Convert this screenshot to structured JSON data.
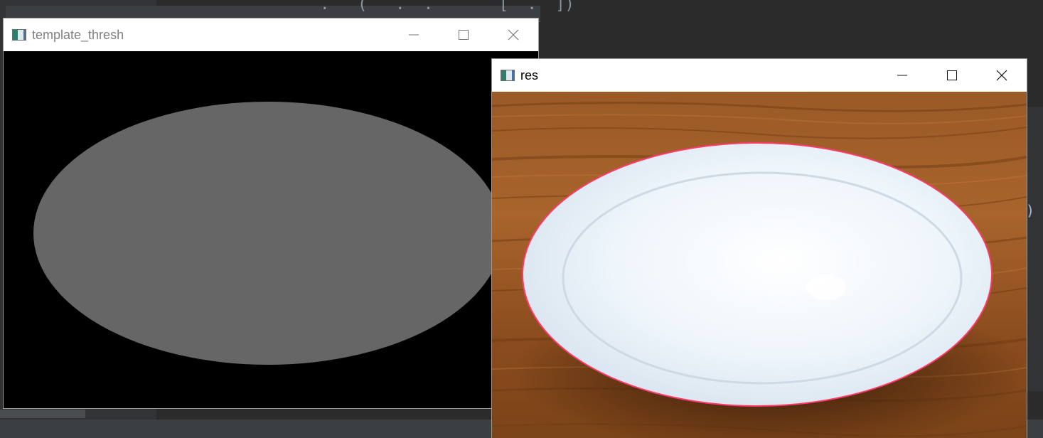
{
  "ide": {
    "code_fragment": "                 .   (   .  .       [  .  ])",
    "scroll_marker": ")"
  },
  "windows": [
    {
      "title": "template_thresh",
      "active": false,
      "image_description_name": "thresholded-ellipse-template",
      "colors": {
        "background": "#000000",
        "ellipse": "#666666"
      }
    },
    {
      "title": "res",
      "active": true,
      "image_description_name": "plate-on-wooden-table-with-contour",
      "colors": {
        "wood_dark": "#6b3a14",
        "wood_light": "#a8642c",
        "plate": "#eef5fb",
        "contour": "#ff3b6b"
      }
    }
  ],
  "controls": {
    "minimize_icon": "minimize-icon",
    "maximize_icon": "maximize-icon",
    "close_icon": "close-icon"
  }
}
